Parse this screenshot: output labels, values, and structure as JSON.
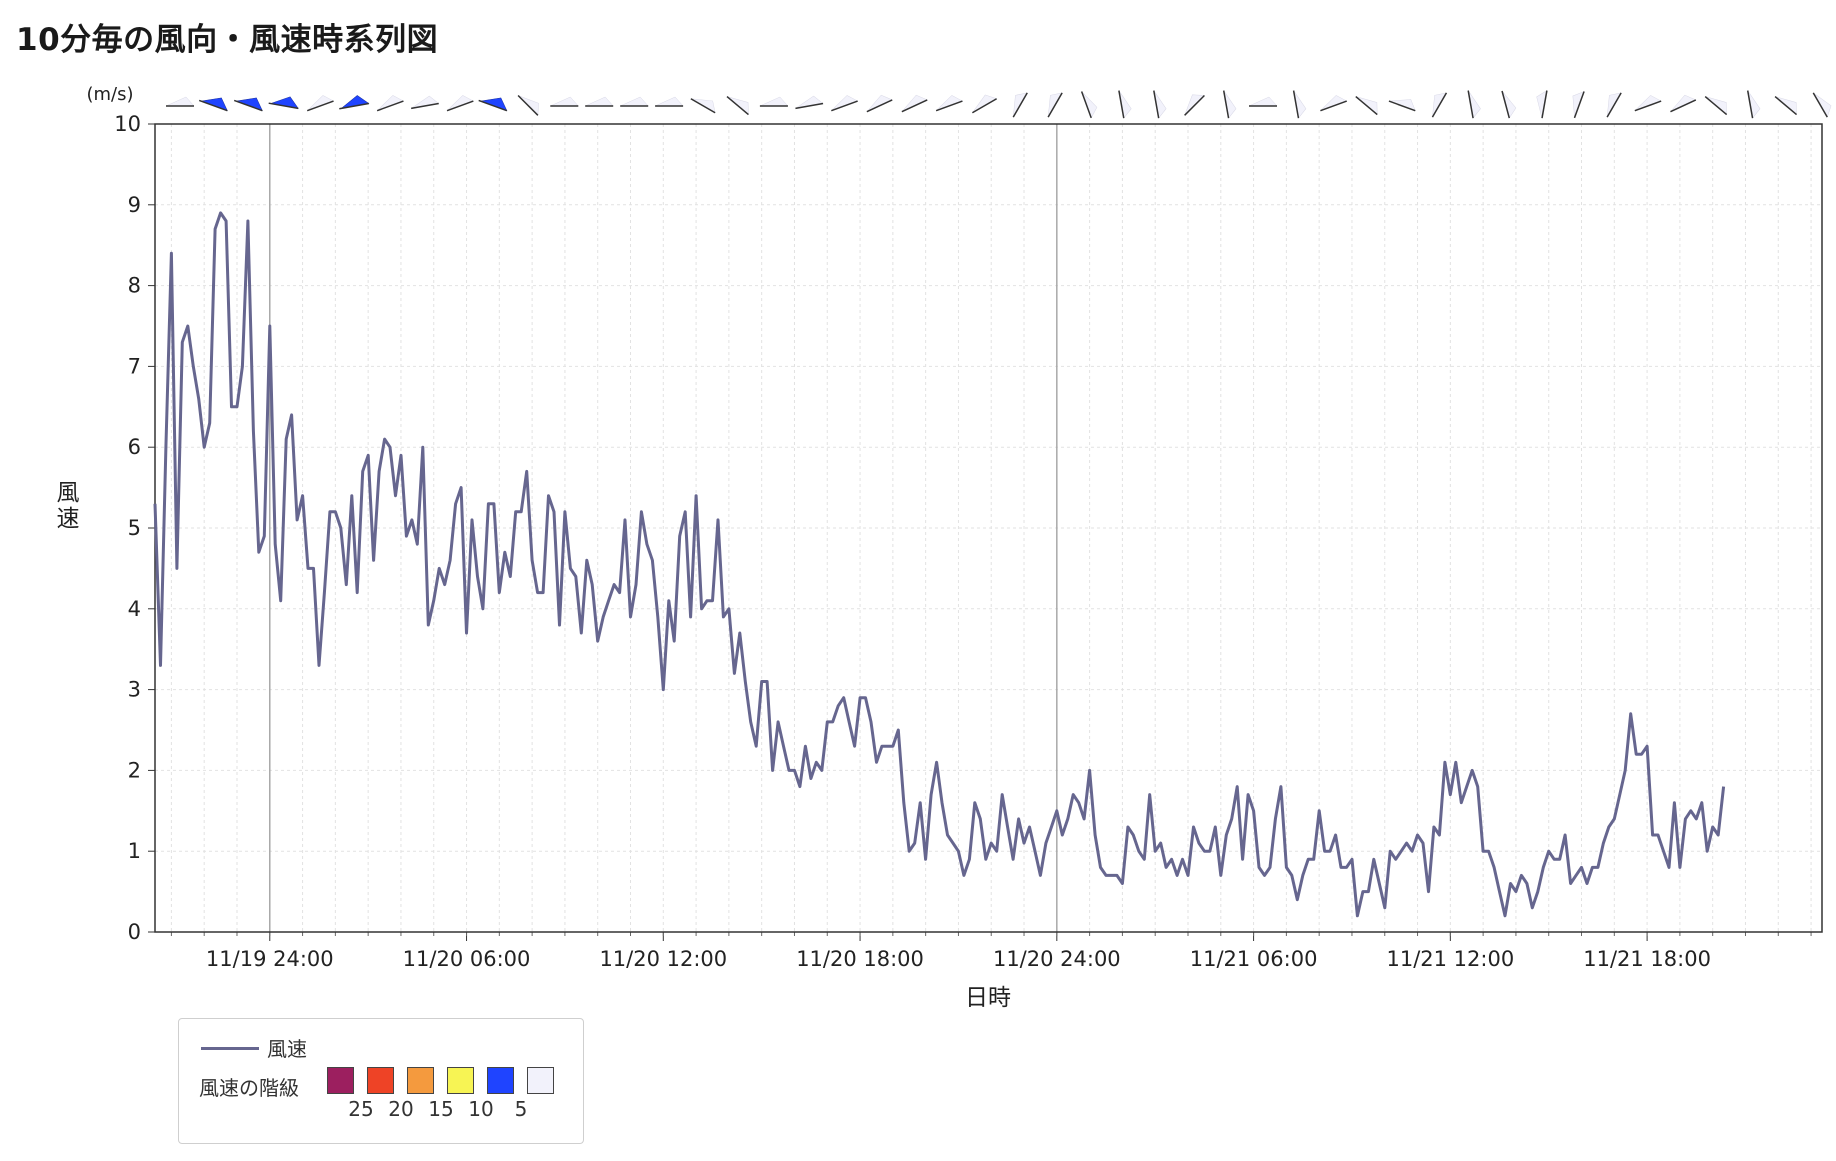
{
  "page": {
    "title": "10分毎の風向・風速時系列図"
  },
  "chart_data": {
    "type": "line",
    "title": "10分毎の風向・風速時系列図",
    "xlabel": "日時",
    "ylabel": "風速",
    "yunit": "(m/s)",
    "ylim": [
      0,
      10
    ],
    "yticks": [
      0,
      1,
      2,
      3,
      4,
      5,
      6,
      7,
      8,
      9,
      10
    ],
    "xlim": [
      "2023-11-19T20:30",
      "2023-11-21T23:20"
    ],
    "xtick_labels": [
      "11/19 24:00",
      "11/20 06:00",
      "11/20 12:00",
      "11/20 18:00",
      "11/20 24:00",
      "11/21 06:00",
      "11/21 12:00",
      "11/21 18:00"
    ],
    "xtick_times": [
      "2023-11-20T00:00",
      "2023-11-20T06:00",
      "2023-11-20T12:00",
      "2023-11-20T18:00",
      "2023-11-21T00:00",
      "2023-11-21T06:00",
      "2023-11-21T12:00",
      "2023-11-21T18:00"
    ],
    "grid": true,
    "legend_position": "bottom-left",
    "series": [
      {
        "name": "風速",
        "color": "#66668f",
        "interval_minutes": 10,
        "start": "2023-11-19T20:30",
        "values": [
          5.3,
          3.3,
          6.0,
          8.4,
          4.5,
          7.3,
          7.5,
          7.0,
          6.6,
          6.0,
          6.3,
          8.7,
          8.9,
          8.8,
          6.5,
          6.5,
          7.0,
          8.8,
          6.2,
          4.7,
          4.9,
          7.5,
          4.8,
          4.1,
          6.1,
          6.4,
          5.1,
          5.4,
          4.5,
          4.5,
          3.3,
          4.2,
          5.2,
          5.2,
          5.0,
          4.3,
          5.4,
          4.2,
          5.7,
          5.9,
          4.6,
          5.7,
          6.1,
          6.0,
          5.4,
          5.9,
          4.9,
          5.1,
          4.8,
          6.0,
          3.8,
          4.1,
          4.5,
          4.3,
          4.6,
          5.3,
          5.5,
          3.7,
          5.1,
          4.4,
          4.0,
          5.3,
          5.3,
          4.2,
          4.7,
          4.4,
          5.2,
          5.2,
          5.7,
          4.6,
          4.2,
          4.2,
          5.4,
          5.2,
          3.8,
          5.2,
          4.5,
          4.4,
          3.7,
          4.6,
          4.3,
          3.6,
          3.9,
          4.1,
          4.3,
          4.2,
          5.1,
          3.9,
          4.3,
          5.2,
          4.8,
          4.6,
          3.9,
          3.0,
          4.1,
          3.6,
          4.9,
          5.2,
          3.9,
          5.4,
          4.0,
          4.1,
          4.1,
          5.1,
          3.9,
          4.0,
          3.2,
          3.7,
          3.1,
          2.6,
          2.3,
          3.1,
          3.1,
          2.0,
          2.6,
          2.3,
          2.0,
          2.0,
          1.8,
          2.3,
          1.9,
          2.1,
          2.0,
          2.6,
          2.6,
          2.8,
          2.9,
          2.6,
          2.3,
          2.9,
          2.9,
          2.6,
          2.1,
          2.3,
          2.3,
          2.3,
          2.5,
          1.6,
          1.0,
          1.1,
          1.6,
          0.9,
          1.7,
          2.1,
          1.6,
          1.2,
          1.1,
          1.0,
          0.7,
          0.9,
          1.6,
          1.4,
          0.9,
          1.1,
          1.0,
          1.7,
          1.3,
          0.9,
          1.4,
          1.1,
          1.3,
          1.0,
          0.7,
          1.1,
          1.3,
          1.5,
          1.2,
          1.4,
          1.7,
          1.6,
          1.4,
          2.0,
          1.2,
          0.8,
          0.7,
          0.7,
          0.7,
          0.6,
          1.3,
          1.2,
          1.0,
          0.9,
          1.7,
          1.0,
          1.1,
          0.8,
          0.9,
          0.7,
          0.9,
          0.7,
          1.3,
          1.1,
          1.0,
          1.0,
          1.3,
          0.7,
          1.2,
          1.4,
          1.8,
          0.9,
          1.7,
          1.5,
          0.8,
          0.7,
          0.8,
          1.4,
          1.8,
          0.8,
          0.7,
          0.4,
          0.7,
          0.9,
          0.9,
          1.5,
          1.0,
          1.0,
          1.2,
          0.8,
          0.8,
          0.9,
          0.2,
          0.5,
          0.5,
          0.9,
          0.6,
          0.3,
          1.0,
          0.9,
          1.0,
          1.1,
          1.0,
          1.2,
          1.1,
          0.5,
          1.3,
          1.2,
          2.1,
          1.7,
          2.1,
          1.6,
          1.8,
          2.0,
          1.8,
          1.0,
          1.0,
          0.8,
          0.5,
          0.2,
          0.6,
          0.5,
          0.7,
          0.6,
          0.3,
          0.5,
          0.8,
          1.0,
          0.9,
          0.9,
          1.2,
          0.6,
          0.7,
          0.8,
          0.6,
          0.8,
          0.8,
          1.1,
          1.3,
          1.4,
          1.7,
          2.0,
          2.7,
          2.2,
          2.2,
          2.3,
          1.2,
          1.2,
          1.0,
          0.8,
          1.6,
          0.8,
          1.4,
          1.5,
          1.4,
          1.6,
          1.0,
          1.3,
          1.2,
          1.8
        ]
      }
    ],
    "wind_direction_arrows": [
      {
        "angle": 0,
        "cls": 0
      },
      {
        "angle": 20,
        "cls": 1
      },
      {
        "angle": 20,
        "cls": 1
      },
      {
        "angle": 10,
        "cls": 1
      },
      {
        "angle": -20,
        "cls": 0
      },
      {
        "angle": -10,
        "cls": 1
      },
      {
        "angle": -20,
        "cls": 0
      },
      {
        "angle": -10,
        "cls": 0
      },
      {
        "angle": -20,
        "cls": 0
      },
      {
        "angle": 20,
        "cls": 1
      },
      {
        "angle": 45,
        "cls": 0
      },
      {
        "angle": 0,
        "cls": 0
      },
      {
        "angle": 0,
        "cls": 0
      },
      {
        "angle": 0,
        "cls": 0
      },
      {
        "angle": 0,
        "cls": 0
      },
      {
        "angle": 30,
        "cls": 0
      },
      {
        "angle": 40,
        "cls": 0
      },
      {
        "angle": 0,
        "cls": 0
      },
      {
        "angle": -10,
        "cls": 0
      },
      {
        "angle": -20,
        "cls": 0
      },
      {
        "angle": -25,
        "cls": 0
      },
      {
        "angle": -25,
        "cls": 0
      },
      {
        "angle": -20,
        "cls": 0
      },
      {
        "angle": -30,
        "cls": 0
      },
      {
        "angle": -60,
        "cls": 0
      },
      {
        "angle": -60,
        "cls": 0
      },
      {
        "angle": 70,
        "cls": 0
      },
      {
        "angle": 80,
        "cls": 0
      },
      {
        "angle": 80,
        "cls": 0
      },
      {
        "angle": -45,
        "cls": 0
      },
      {
        "angle": 80,
        "cls": 0
      },
      {
        "angle": 0,
        "cls": 0
      },
      {
        "angle": 80,
        "cls": 0
      },
      {
        "angle": -20,
        "cls": 0
      },
      {
        "angle": 40,
        "cls": 0
      },
      {
        "angle": 20,
        "cls": 0
      },
      {
        "angle": -60,
        "cls": 0
      },
      {
        "angle": 80,
        "cls": 0
      },
      {
        "angle": 75,
        "cls": 0
      },
      {
        "angle": -80,
        "cls": 0
      },
      {
        "angle": -70,
        "cls": 0
      },
      {
        "angle": -60,
        "cls": 0
      },
      {
        "angle": -20,
        "cls": 0
      },
      {
        "angle": -25,
        "cls": 0
      },
      {
        "angle": 40,
        "cls": 0
      },
      {
        "angle": 80,
        "cls": 0
      },
      {
        "angle": 40,
        "cls": 0
      },
      {
        "angle": 60,
        "cls": 0
      }
    ],
    "speed_classes": [
      {
        "label": "25",
        "color": "#9c1f5f"
      },
      {
        "label": "20",
        "color": "#ee4326"
      },
      {
        "label": "15",
        "color": "#f49a3e"
      },
      {
        "label": "10",
        "color": "#f7f454"
      },
      {
        "label": "5",
        "color": "#1f44ff"
      },
      {
        "label": "",
        "color": "#f2f2fb"
      }
    ]
  },
  "legend": {
    "line_label": "風速",
    "scale_label": "風速の階級"
  }
}
